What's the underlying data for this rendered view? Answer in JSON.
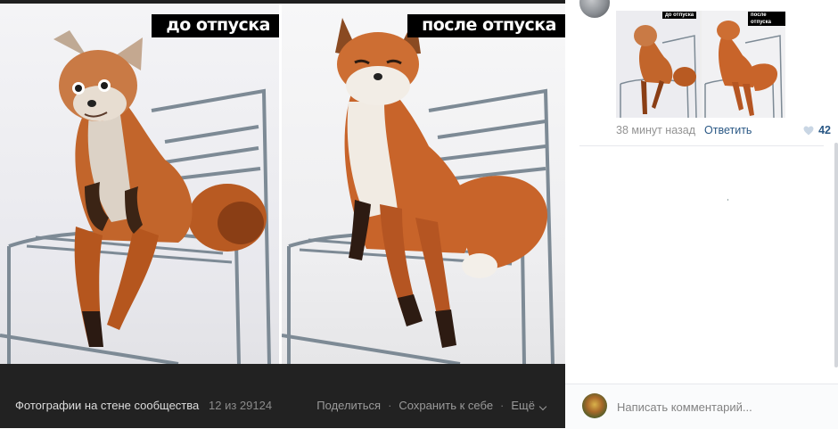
{
  "viewer": {
    "caption_before": "до отпуска",
    "caption_after": "после отпуска",
    "footer": {
      "title": "Фотографии на стене сообщества",
      "counter": "12 из 29124",
      "share": "Поделиться",
      "save": "Сохранить к себе",
      "more": "Ещё",
      "separator": "·"
    }
  },
  "comment": {
    "thumb_caption_before": "до отпуска",
    "thumb_caption_after": "после отпуска",
    "time": "38 минут назад",
    "reply": "Ответить",
    "likes": "42"
  },
  "composer": {
    "placeholder": "Написать комментарий..."
  },
  "colors": {
    "footer_bg": "#222222",
    "link": "#2a5885",
    "fox": "#c8642a"
  }
}
